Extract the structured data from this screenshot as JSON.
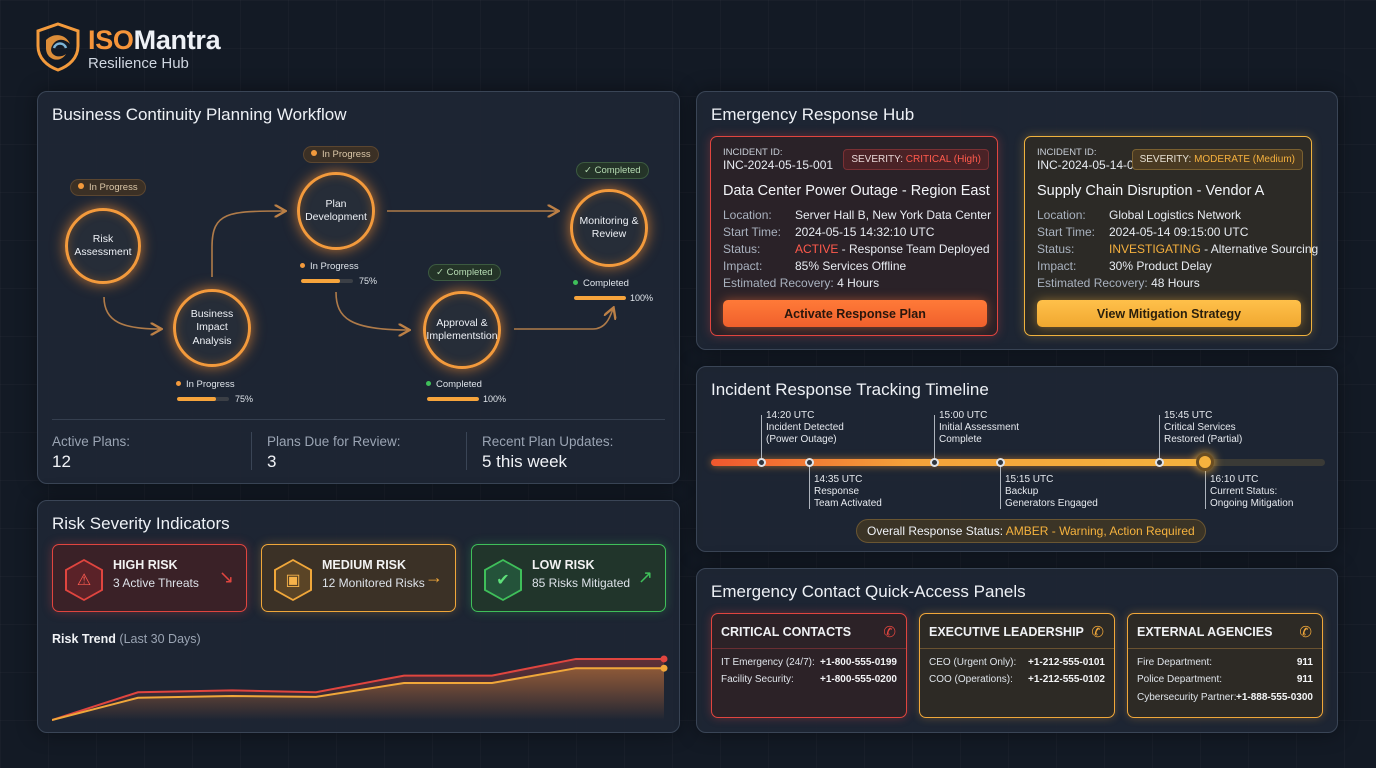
{
  "brand": {
    "iso": "ISO",
    "mantra": "Mantra",
    "subtitle": "Resilience Hub"
  },
  "bcp": {
    "title": "Business Continuity Planning Workflow",
    "nodes": [
      {
        "label": "Risk\nAssessment",
        "status": "In Progress"
      },
      {
        "label": "Business\nImpact\nAnalysis",
        "status": "In Progress",
        "progress": 75,
        "pct": "75%"
      },
      {
        "label": "Plan\nDevelopment",
        "status": "In Progress",
        "progress": 75,
        "pct": "75%"
      },
      {
        "label": "Approval &\nImplementstion",
        "status": "Completed",
        "progress": 100,
        "pct": "100%"
      },
      {
        "label": "Monitoring &\nReview",
        "status": "Completed",
        "progress": 100,
        "pct": "100%"
      }
    ],
    "chip_in_progress": "In Progress",
    "chip_completed": "✓ Completed",
    "summary": [
      {
        "label": "Active Plans:",
        "value": "12"
      },
      {
        "label": "Plans Due for Review:",
        "value": "3"
      },
      {
        "label": "Recent Plan Updates:",
        "value": "5 this week"
      }
    ]
  },
  "risk": {
    "title": "Risk Severity Indicators",
    "cards": [
      {
        "title": "HIGH RISK",
        "sub": "3 Active Threats",
        "color": "#e0453f"
      },
      {
        "title": "MEDIUM RISK",
        "sub": "12 Monitored Risks",
        "color": "#f0a73a"
      },
      {
        "title": "LOW RISK",
        "sub": "85 Risks Mitigated",
        "color": "#3fbf5a"
      }
    ],
    "trend_label": "Risk Trend",
    "trend_period": "(Last 30 Days)",
    "chart_data": {
      "type": "line",
      "x": [
        0,
        1,
        2,
        3,
        4,
        5,
        6,
        7
      ],
      "series": [
        {
          "values": [
            0,
            30,
            32,
            30,
            48,
            48,
            66,
            66
          ],
          "color": "#e0453f"
        },
        {
          "values": [
            0,
            24,
            26,
            25,
            40,
            40,
            56,
            56
          ],
          "color": "#f0a73a"
        }
      ],
      "ylim": [
        0,
        80
      ],
      "grid": false
    }
  },
  "erh": {
    "title": "Emergency Response Hub",
    "incidents": [
      {
        "id_label": "INCIDENT ID:",
        "id": "INC-2024-05-15-001",
        "sev_label": "SEVERITY:",
        "sev_value": "CRITICAL (High)",
        "title": "Data Center Power Outage - Region East",
        "loc_label": "Location:",
        "loc": "Server Hall B, New York Data Center",
        "start_label": "Start Time:",
        "start": "2024-05-15 14:32:10 UTC",
        "status_label": "Status:",
        "status_key": "ACTIVE",
        "status_rest": " - Response Team Deployed",
        "impact_label": "Impact:",
        "impact": "85% Services Offline",
        "rec_label": "Estimated Recovery:",
        "rec": "4 Hours",
        "button": "Activate Response Plan",
        "color": "#e8503c"
      },
      {
        "id_label": "INCIDENT ID:",
        "id": "INC-2024-05-14-003",
        "sev_label": "SEVERITY:",
        "sev_value": "MODERATE (Medium)",
        "title": "Supply Chain Disruption - Vendor A",
        "loc_label": "Location:",
        "loc": "Global Logistics Network",
        "start_label": "Start Time:",
        "start": "2024-05-14 09:15:00 UTC",
        "status_label": "Status:",
        "status_key": "INVESTIGATING",
        "status_rest": " - Alternative Sourcing",
        "impact_label": "Impact:",
        "impact": "30% Product Delay",
        "rec_label": "Estimated Recovery:",
        "rec": "48 Hours",
        "button": "View Mitigation Strategy",
        "color": "#f0b23e"
      }
    ]
  },
  "timeline": {
    "title": "Incident Response Tracking Timeline",
    "events": [
      {
        "time": "14:20 UTC",
        "text": "Incident Detected\n(Power Outage)"
      },
      {
        "time": "14:35 UTC",
        "text": "Response\nTeam Activated"
      },
      {
        "time": "15:00 UTC",
        "text": "Initial Assessment\nComplete"
      },
      {
        "time": "15:15 UTC",
        "text": "Backup\nGenerators Engaged"
      },
      {
        "time": "15:45 UTC",
        "text": "Critical Services\nRestored (Partial)"
      },
      {
        "time": "16:10 UTC",
        "text": "Current Status:\nOngoing Mitigation"
      }
    ],
    "overall_label": "Overall Response Status: ",
    "overall_value": "AMBER - Warning, Action Required"
  },
  "contacts": {
    "title": "Emergency Contact Quick-Access Panels",
    "cards": [
      {
        "title": "CRITICAL CONTACTS",
        "color": "#e0453f",
        "rows": [
          {
            "name": "IT Emergency (24/7):",
            "num": "+1-800-555-0199"
          },
          {
            "name": "Facility Security:",
            "num": "+1-800-555-0200"
          }
        ]
      },
      {
        "title": "EXECUTIVE LEADERSHIP",
        "color": "#f0a73a",
        "rows": [
          {
            "name": "CEO (Urgent Only):",
            "num": "+1-212-555-0101"
          },
          {
            "name": "COO (Operations):",
            "num": "+1-212-555-0102"
          }
        ]
      },
      {
        "title": "EXTERNAL AGENCIES",
        "color": "#f0a73a",
        "rows": [
          {
            "name": "Fire Department:",
            "num": "911"
          },
          {
            "name": "Police Department:",
            "num": "911"
          },
          {
            "name": "Cybersecurity Partner:",
            "num": "+1-888-555-0300"
          }
        ]
      }
    ]
  }
}
